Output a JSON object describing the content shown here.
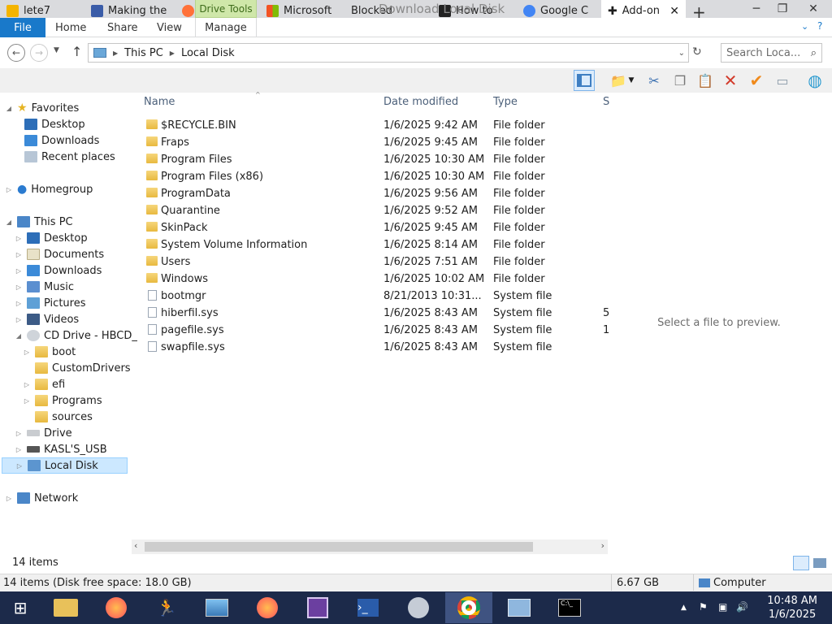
{
  "browser_tabs": [
    {
      "label": "lete7",
      "color": "#f4b400"
    },
    {
      "label": "Making the",
      "color": "#3a5ca8"
    },
    {
      "label": "",
      "color": "#ff7139"
    },
    {
      "label": "Microsoft",
      "color": "#f35325"
    },
    {
      "label": "Blocked",
      "color": "#dadbde"
    },
    {
      "label": "How to",
      "color": "#222222"
    },
    {
      "label": "Google C",
      "color": "#4285f4"
    }
  ],
  "active_tab": "Add-on",
  "window_title": "Download   Local Disk",
  "drive_tools": "Drive Tools",
  "ribbon": {
    "file": "File",
    "home": "Home",
    "share": "Share",
    "view": "View",
    "manage": "Manage"
  },
  "address": {
    "this_pc": "This PC",
    "local_disk": "Local Disk"
  },
  "search": {
    "placeholder": "Search Loca..."
  },
  "nav": {
    "favorites": "Favorites",
    "fav_items": [
      "Desktop",
      "Downloads",
      "Recent places"
    ],
    "homegroup": "Homegroup",
    "this_pc": "This PC",
    "pc_items": [
      "Desktop",
      "Documents",
      "Downloads",
      "Music",
      "Pictures",
      "Videos"
    ],
    "cd_drive": "CD Drive - HBCD_",
    "cd_items": [
      "boot",
      "CustomDrivers",
      "efi",
      "Programs",
      "sources"
    ],
    "drive": "Drive",
    "usb": "KASL'S_USB",
    "local_disk": "Local Disk",
    "network": "Network"
  },
  "columns": {
    "name": "Name",
    "date": "Date modified",
    "type": "Type",
    "size": "S"
  },
  "files": [
    {
      "name": "$RECYCLE.BIN",
      "date": "1/6/2025 9:42 AM",
      "type": "File folder",
      "size": "",
      "kind": "folder"
    },
    {
      "name": "Fraps",
      "date": "1/6/2025 9:45 AM",
      "type": "File folder",
      "size": "",
      "kind": "folder"
    },
    {
      "name": "Program Files",
      "date": "1/6/2025 10:30 AM",
      "type": "File folder",
      "size": "",
      "kind": "folder"
    },
    {
      "name": "Program Files (x86)",
      "date": "1/6/2025 10:30 AM",
      "type": "File folder",
      "size": "",
      "kind": "folder"
    },
    {
      "name": "ProgramData",
      "date": "1/6/2025 9:56 AM",
      "type": "File folder",
      "size": "",
      "kind": "folder"
    },
    {
      "name": "Quarantine",
      "date": "1/6/2025 9:52 AM",
      "type": "File folder",
      "size": "",
      "kind": "folder"
    },
    {
      "name": "SkinPack",
      "date": "1/6/2025 9:45 AM",
      "type": "File folder",
      "size": "",
      "kind": "folder"
    },
    {
      "name": "System Volume Information",
      "date": "1/6/2025 8:14 AM",
      "type": "File folder",
      "size": "",
      "kind": "folder"
    },
    {
      "name": "Users",
      "date": "1/6/2025 7:51 AM",
      "type": "File folder",
      "size": "",
      "kind": "folder"
    },
    {
      "name": "Windows",
      "date": "1/6/2025 10:02 AM",
      "type": "File folder",
      "size": "",
      "kind": "folder"
    },
    {
      "name": "bootmgr",
      "date": "8/21/2013 10:31...",
      "type": "System file",
      "size": "",
      "kind": "system"
    },
    {
      "name": "hiberfil.sys",
      "date": "1/6/2025 8:43 AM",
      "type": "System file",
      "size": "5",
      "kind": "system"
    },
    {
      "name": "pagefile.sys",
      "date": "1/6/2025 8:43 AM",
      "type": "System file",
      "size": "1",
      "kind": "system"
    },
    {
      "name": "swapfile.sys",
      "date": "1/6/2025 8:43 AM",
      "type": "System file",
      "size": "",
      "kind": "system"
    }
  ],
  "preview_text": "Select a file to preview.",
  "status": {
    "items": "14 items",
    "detail": "14 items (Disk free space: 18.0 GB)",
    "size": "6.67 GB",
    "location": "Computer"
  },
  "taskbar": {
    "time": "10:48 AM",
    "date": "1/6/2025"
  }
}
